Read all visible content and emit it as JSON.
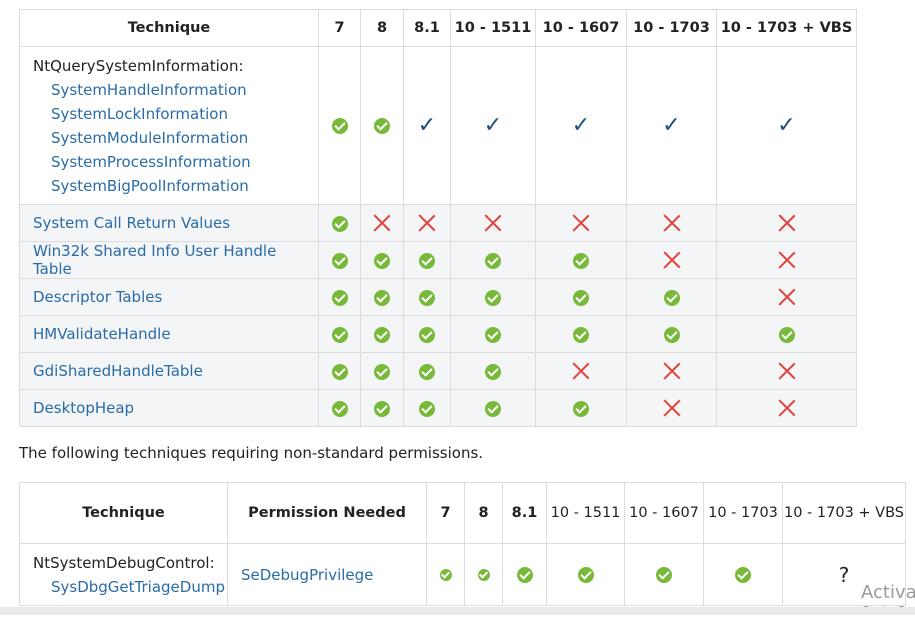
{
  "table1": {
    "headers": [
      "Technique",
      "7",
      "8",
      "8.1",
      "10 - 1511",
      "10 - 1607",
      "10 - 1703",
      "10 - 1703 + VBS"
    ],
    "rows": [
      {
        "technique": "NtQuerySystemInformation:",
        "subitems": [
          "SystemHandleInformation",
          "SystemLockInformation",
          "SystemModuleInformation",
          "SystemProcessInformation",
          "SystemBigPoolInformation"
        ],
        "status": [
          "ok",
          "ok",
          "tick",
          "tick",
          "tick",
          "tick",
          "tick"
        ]
      },
      {
        "technique": "System Call Return Values",
        "status": [
          "ok",
          "cross",
          "cross",
          "cross",
          "cross",
          "cross",
          "cross"
        ]
      },
      {
        "technique": "Win32k Shared Info User Handle Table",
        "status": [
          "ok",
          "ok",
          "ok",
          "ok",
          "ok",
          "cross",
          "cross"
        ]
      },
      {
        "technique": "Descriptor Tables",
        "status": [
          "ok",
          "ok",
          "ok",
          "ok",
          "ok",
          "ok",
          "cross"
        ]
      },
      {
        "technique": "HMValidateHandle",
        "status": [
          "ok",
          "ok",
          "ok",
          "ok",
          "ok",
          "ok",
          "ok"
        ]
      },
      {
        "technique": "GdiSharedHandleTable",
        "status": [
          "ok",
          "ok",
          "ok",
          "ok",
          "cross",
          "cross",
          "cross"
        ]
      },
      {
        "technique": "DesktopHeap",
        "status": [
          "ok",
          "ok",
          "ok",
          "ok",
          "ok",
          "cross",
          "cross"
        ]
      }
    ]
  },
  "note": "The following techniques requiring non-standard permissions.",
  "table2": {
    "headers": [
      "Technique",
      "Permission Needed",
      "7",
      "8",
      "8.1",
      "10 - 1511",
      "10 - 1607",
      "10 - 1703",
      "10 - 1703 + VBS"
    ],
    "rows": [
      {
        "technique": "NtSystemDebugControl:",
        "subitems": [
          "SysDbgGetTriageDump"
        ],
        "permission": "SeDebugPrivilege",
        "status": [
          "ok-sm",
          "ok-sm",
          "ok",
          "ok",
          "ok",
          "ok",
          "?"
        ]
      }
    ]
  },
  "watermark": {
    "line1": "Activa",
    "line2": "Go to Se"
  },
  "icons": {
    "ok": "green-check-circle-icon",
    "tick": "blue-checkmark-icon",
    "cross": "red-x-icon"
  },
  "colors": {
    "ok": "#79b93a",
    "tick": "#1f4e79",
    "cross": "#e0443c",
    "link": "#2a6ca8"
  }
}
